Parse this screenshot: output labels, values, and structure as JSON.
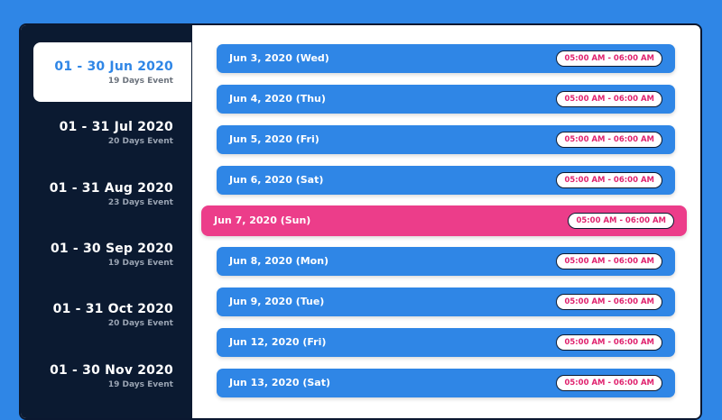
{
  "sidebar": {
    "items": [
      {
        "range": "01 - 30 Jun 2020",
        "days": "19 Days Event"
      },
      {
        "range": "01 - 31 Jul 2020",
        "days": "20 Days Event"
      },
      {
        "range": "01 - 31 Aug 2020",
        "days": "23 Days Event"
      },
      {
        "range": "01 - 30 Sep 2020",
        "days": "19 Days Event"
      },
      {
        "range": "01 - 31 Oct 2020",
        "days": "20 Days Event"
      },
      {
        "range": "01 - 30 Nov 2020",
        "days": "19 Days Event"
      }
    ]
  },
  "events": [
    {
      "date": "Jun 3, 2020 (Wed)",
      "time": "05:00 AM - 06:00 AM"
    },
    {
      "date": "Jun 4, 2020 (Thu)",
      "time": "05:00 AM - 06:00 AM"
    },
    {
      "date": "Jun 5, 2020 (Fri)",
      "time": "05:00 AM - 06:00 AM"
    },
    {
      "date": "Jun 6, 2020 (Sat)",
      "time": "05:00 AM - 06:00 AM"
    },
    {
      "date": "Jun 7, 2020 (Sun)",
      "time": "05:00 AM - 06:00 AM"
    },
    {
      "date": "Jun 8, 2020 (Mon)",
      "time": "05:00 AM - 06:00 AM"
    },
    {
      "date": "Jun 9, 2020 (Tue)",
      "time": "05:00 AM - 06:00 AM"
    },
    {
      "date": "Jun 12, 2020 (Fri)",
      "time": "05:00 AM - 06:00 AM"
    },
    {
      "date": "Jun 13, 2020 (Sat)",
      "time": "05:00 AM - 06:00 AM"
    }
  ],
  "colors": {
    "background": "#2f86e6",
    "sidebar": "#0b1a31",
    "event": "#2f86e6",
    "event_highlight": "#ec3d8a",
    "time_text": "#e0226e"
  }
}
